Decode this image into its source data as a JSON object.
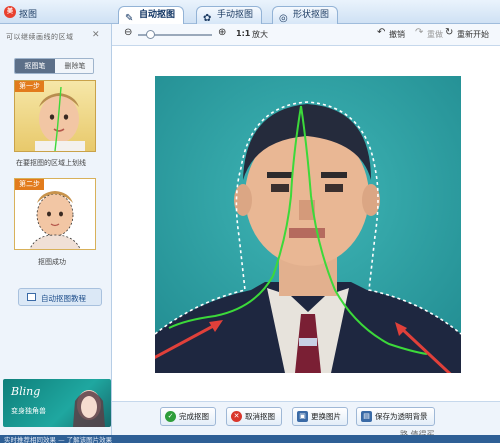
{
  "app": {
    "title": "抠图",
    "logo_text": "美"
  },
  "tabs": [
    {
      "label": "自动抠图",
      "icon": "brush-icon",
      "active": true
    },
    {
      "label": "手动抠图",
      "icon": "gear-icon",
      "active": false
    },
    {
      "label": "形状抠图",
      "icon": "shape-icon",
      "active": false
    }
  ],
  "sidebar": {
    "hint": "可以继续画线的区域",
    "mode_tabs": [
      "抠图笔",
      "删除笔"
    ],
    "steps": [
      {
        "badge": "第一步",
        "caption": "在要抠图的区域上划线"
      },
      {
        "badge": "第二步",
        "caption": "抠图成功"
      }
    ],
    "tutorial_label": "自动抠图教程",
    "ad": {
      "title": "Bling",
      "subtitle": "变身独角兽"
    }
  },
  "toolbar": {
    "zoom_ratio": "1:1",
    "fit_label": "放大",
    "undo_label": "撤销",
    "redo_label": "重做",
    "restart_label": "重新开始"
  },
  "actions": [
    {
      "label": "完成抠图",
      "icon": "check-icon",
      "color": "#2e9d3a"
    },
    {
      "label": "取消抠图",
      "icon": "cancel-icon",
      "color": "#d9362b"
    },
    {
      "label": "更换图片",
      "icon": "image-icon",
      "color": "#3a6aa6"
    },
    {
      "label": "保存为透明背景",
      "icon": "save-icon",
      "color": "#3a6aa6"
    }
  ],
  "watermark": "路 值得买",
  "status": {
    "text": "实时推荐相同效果 — 了解该图片效果"
  },
  "colors": {
    "photo_bg": "#2ea6a8",
    "stroke": "#3cd93a",
    "arrow": "#e0403a"
  }
}
